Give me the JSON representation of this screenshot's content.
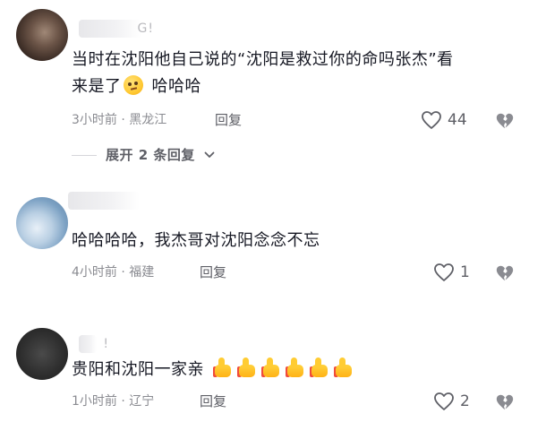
{
  "comments": [
    {
      "username_tail": "G!",
      "text_line1": "当时在沈阳他自己说的“沈阳是救过你的命吗张杰”看",
      "text_line2_prefix": "来是了",
      "text_line2_suffix": "哈哈哈",
      "time": "3小时前 · 黑龙江",
      "reply": "回复",
      "likes": "44",
      "emoji": "thinking-face",
      "expand": "展开 2 条回复"
    },
    {
      "username_tail": "",
      "text_line1": "哈哈哈哈，我杰哥对沈阳念念不忘",
      "time": "4小时前 · 福建",
      "reply": "回复",
      "likes": "1"
    },
    {
      "username_tail": "!",
      "text_line1": "贵阳和沈阳一家亲",
      "time": "1小时前 · 辽宁",
      "reply": "回复",
      "likes": "2",
      "emoji": "thumbs-up x6"
    }
  ],
  "colors": {
    "text": "#161823",
    "meta": "#8a8b91",
    "action": "#5e5f66"
  }
}
